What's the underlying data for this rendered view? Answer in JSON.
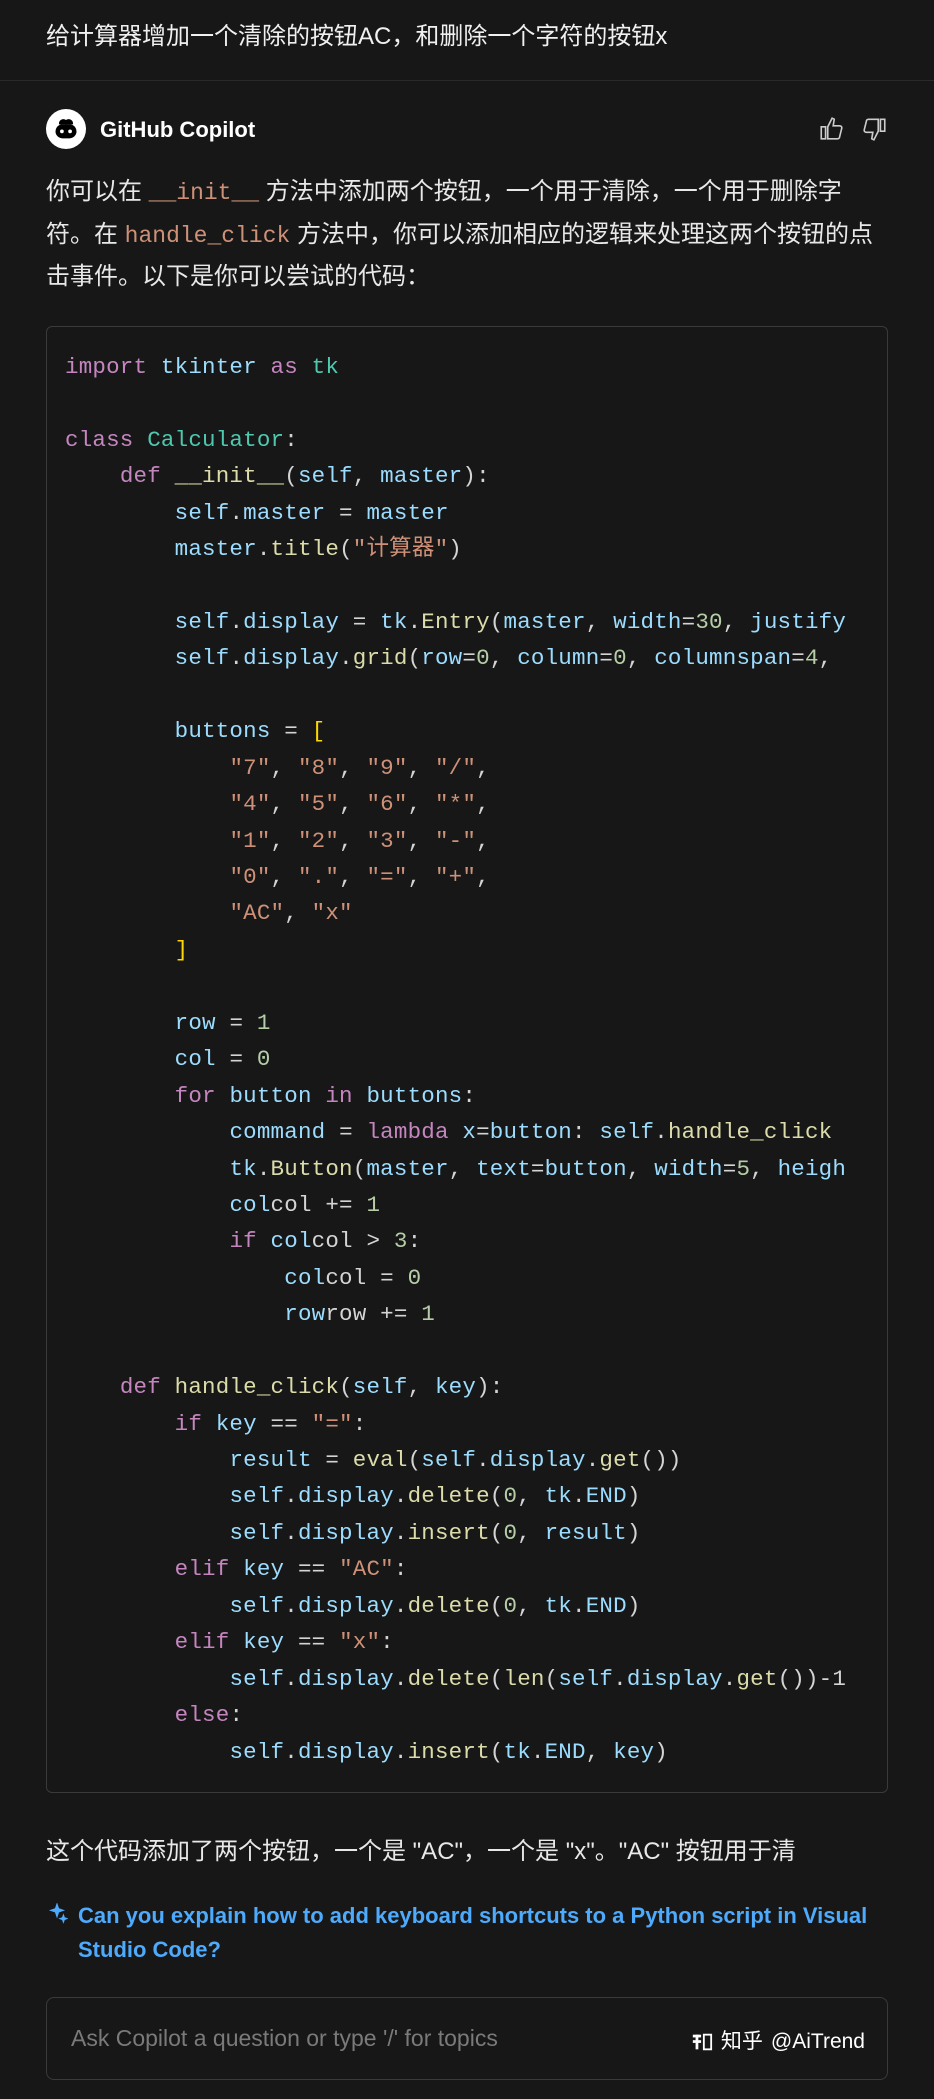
{
  "user_prompt": "给计算器增加一个清除的按钮AC，和删除一个字符的按钮x",
  "author": "GitHub Copilot",
  "intro": {
    "p1a": "你可以在 ",
    "p1_code1": "__init__",
    "p1b": " 方法中添加两个按钮，一个用于清除，一个用于删除字符。在 ",
    "p1_code2": "handle_click",
    "p1c": " 方法中，你可以添加相应的逻辑来处理这两个按钮的点击事件。以下是你可以尝试的代码："
  },
  "followup": "这个代码添加了两个按钮，一个是 \"AC\"，一个是 \"x\"。\"AC\" 按钮用于清",
  "suggestion": "Can you explain how to add keyboard shortcuts to a Python script in Visual Studio Code?",
  "input_placeholder": "Ask Copilot a question or type '/' for topics",
  "watermark_site": "知乎",
  "watermark_user": "@AiTrend",
  "code": {
    "l01_import": "import",
    "l01_mod": "tkinter",
    "l01_as": "as",
    "l01_alias": "tk",
    "l02_class": "class",
    "l02_name": "Calculator",
    "l03_def": "def",
    "l03_fn": "__init__",
    "l03_self": "self",
    "l03_master": "master",
    "l04_self": "self",
    "l04_master1": "master",
    "l04_eq": " = ",
    "l04_master2": "master",
    "l05_master": "master",
    "l05_title": "title",
    "l05_str": "\"计算器\"",
    "l06_self": "self",
    "l06_display": "display",
    "l06_tk": "tk",
    "l06_entry": "Entry",
    "l06_master": "master",
    "l06_width": "width",
    "l06_30": "30",
    "l06_justify": "justify",
    "l07_self": "self",
    "l07_display": "display",
    "l07_grid": "grid",
    "l07_row": "row",
    "l07_0a": "0",
    "l07_col": "column",
    "l07_0b": "0",
    "l07_colspan": "columnspan",
    "l07_4": "4",
    "l08_buttons": "buttons",
    "row1": {
      "a": "\"7\"",
      "b": "\"8\"",
      "c": "\"9\"",
      "d": "\"/\""
    },
    "row2": {
      "a": "\"4\"",
      "b": "\"5\"",
      "c": "\"6\"",
      "d": "\"*\""
    },
    "row3": {
      "a": "\"1\"",
      "b": "\"2\"",
      "c": "\"3\"",
      "d": "\"-\""
    },
    "row4": {
      "a": "\"0\"",
      "b": "\".\"",
      "c": "\"=\"",
      "d": "\"+\""
    },
    "row5": {
      "a": "\"AC\"",
      "b": "\"x\""
    },
    "l_rowvar": "row",
    "l_row1": "1",
    "l_colvar": "col",
    "l_col0": "0",
    "l_for": "for",
    "l_button": "button",
    "l_in": "in",
    "l_buttons2": "buttons",
    "l_command": "command",
    "l_lambda": "lambda",
    "l_x": "x",
    "l_button2": "button",
    "l_self2": "self",
    "l_hc": "handle_click",
    "l_tk2": "tk",
    "l_Button": "Button",
    "l_master2": "master",
    "l_text": "text",
    "l_button3": "button",
    "l_width2": "width",
    "l_5": "5",
    "l_height": "heigh",
    "l_colpe": "col += ",
    "l_1b": "1",
    "l_if": "if",
    "l_col_gt": "col > ",
    "l_3": "3",
    "l_coleq0": "col = ",
    "l_0c": "0",
    "l_rowpe": "row += ",
    "l_1c": "1",
    "hc_def": "def",
    "hc_fn": "handle_click",
    "hc_self": "self",
    "hc_key": "key",
    "hc_if": "if",
    "hc_key2": "key",
    "hc_eqeq": " == ",
    "hc_eqstr": "\"=\"",
    "hc_result": "result",
    "hc_eval": "eval",
    "hc_self2": "self",
    "hc_disp": "display",
    "hc_get": "get",
    "hc_self3": "self",
    "hc_disp2": "display",
    "hc_delete": "delete",
    "hc_0a": "0",
    "hc_tk": "tk",
    "hc_END": "END",
    "hc_self4": "self",
    "hc_disp3": "display",
    "hc_insert": "insert",
    "hc_0b": "0",
    "hc_result2": "result",
    "hc_elif1": "elif",
    "hc_key3": "key",
    "hc_ac": "\"AC\"",
    "hc_self5": "self",
    "hc_disp4": "display",
    "hc_delete2": "delete",
    "hc_0c": "0",
    "hc_tk2": "tk",
    "hc_END2": "END",
    "hc_elif2": "elif",
    "hc_key4": "key",
    "hc_xstr": "\"x\"",
    "hc_self6": "self",
    "hc_disp5": "display",
    "hc_delete3": "delete",
    "hc_len": "len",
    "hc_self7": "self",
    "hc_disp6": "display",
    "hc_get2": "get",
    "hc_minus1": ")-1",
    "hc_else": "else",
    "hc_self8": "self",
    "hc_disp7": "display",
    "hc_insert2": "insert",
    "hc_tk3": "tk",
    "hc_END3": "END",
    "hc_keyv": "key"
  }
}
